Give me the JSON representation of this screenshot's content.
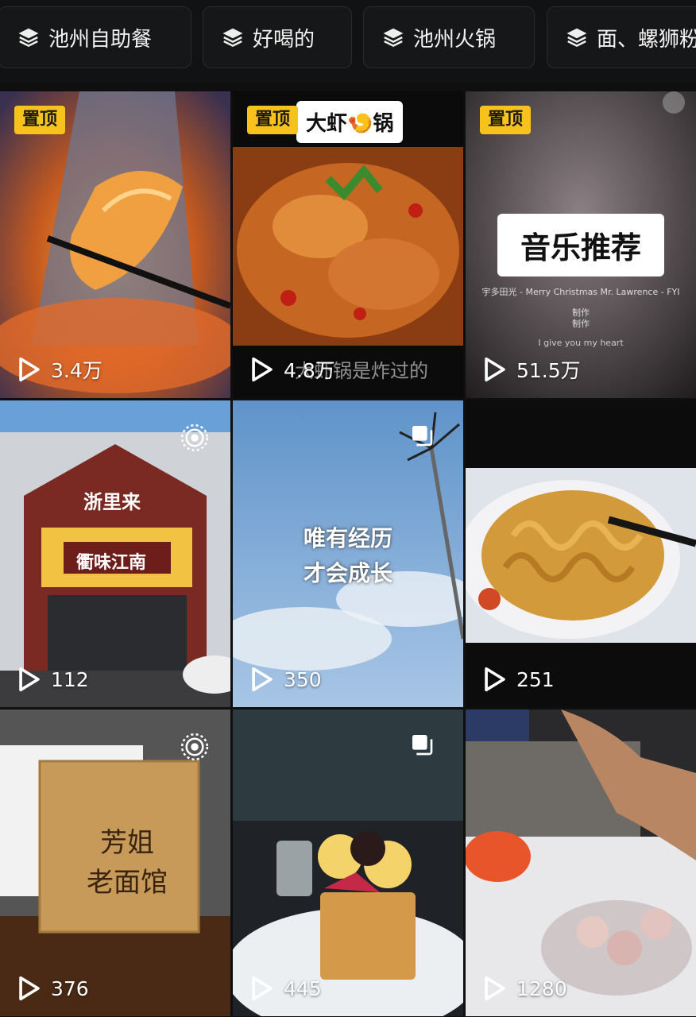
{
  "collections": [
    {
      "label": "池州自助餐"
    },
    {
      "label": "好喝的"
    },
    {
      "label": "池州火锅"
    },
    {
      "label": "面、螺狮粉"
    }
  ],
  "videos": [
    {
      "pinned": true,
      "pin_label": "置顶",
      "views": "3.4万",
      "scene": "shrimp-hotpot"
    },
    {
      "pinned": true,
      "pin_label": "置顶",
      "title": "大虾🍤锅",
      "caption": "大虾锅是炸过的",
      "views": "4.8万",
      "scene": "spicy-shrimp-pot"
    },
    {
      "pinned": true,
      "pin_label": "置顶",
      "title": "音乐推荐",
      "lyrics": [
        "宇多田光 - Merry Christmas Mr. Lawrence - FYI",
        "制作",
        "制作",
        "I give you my heart"
      ],
      "views": "51.5万",
      "scene": "music-recommendation"
    },
    {
      "views": "112",
      "signs": [
        "浙里来",
        "衢味江南"
      ],
      "scene": "restaurant-storefront",
      "live_photo": true
    },
    {
      "title_lines": [
        "唯有经历",
        "才会成长"
      ],
      "views": "350",
      "scene": "sky-lamp-post",
      "multi_image": true
    },
    {
      "views": "251",
      "scene": "noodles-plate"
    },
    {
      "views": "376",
      "sign_lines": [
        "芳姐",
        "老面馆"
      ],
      "scene": "wooden-napkin-box",
      "live_photo": true
    },
    {
      "views": "445",
      "scene": "ice-cream-toast",
      "multi_image": true
    },
    {
      "views": "1280",
      "scene": "bbq-buffet-seafood"
    }
  ],
  "colors": {
    "pin_bg": "#f8c21c",
    "background": "#0f0f10"
  }
}
